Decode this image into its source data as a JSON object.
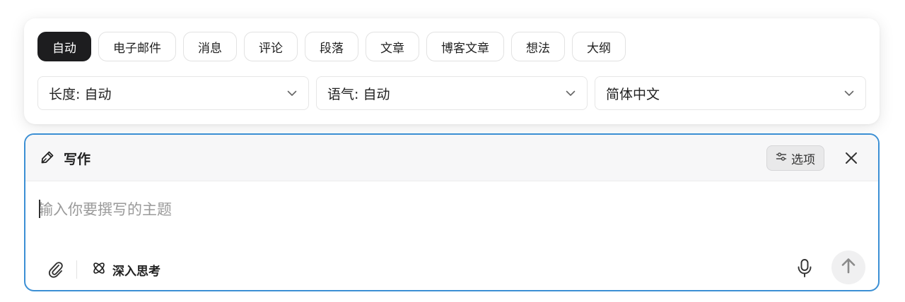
{
  "chips": [
    {
      "label": "自动",
      "active": true
    },
    {
      "label": "电子邮件",
      "active": false
    },
    {
      "label": "消息",
      "active": false
    },
    {
      "label": "评论",
      "active": false
    },
    {
      "label": "段落",
      "active": false
    },
    {
      "label": "文章",
      "active": false
    },
    {
      "label": "博客文章",
      "active": false
    },
    {
      "label": "想法",
      "active": false
    },
    {
      "label": "大纲",
      "active": false
    }
  ],
  "selects": {
    "length": "长度: 自动",
    "tone": "语气: 自动",
    "language": "简体中文"
  },
  "writer": {
    "title": "写作",
    "options_label": "选项",
    "input_value": "",
    "input_placeholder": "输入你要撰写的主题",
    "deep_think_label": "深入思考"
  },
  "colors": {
    "accent_border": "#3b8fd4",
    "active_chip_bg": "#1d1d1f",
    "header_bg": "#f7f7f8"
  },
  "icons": {
    "write": "pencil-icon",
    "options": "sliders-icon",
    "close": "close-icon",
    "attach": "paperclip-icon",
    "deep_think": "atom-icon",
    "mic": "microphone-icon",
    "send": "arrow-up-icon",
    "dropdown": "chevron-down-icon"
  }
}
